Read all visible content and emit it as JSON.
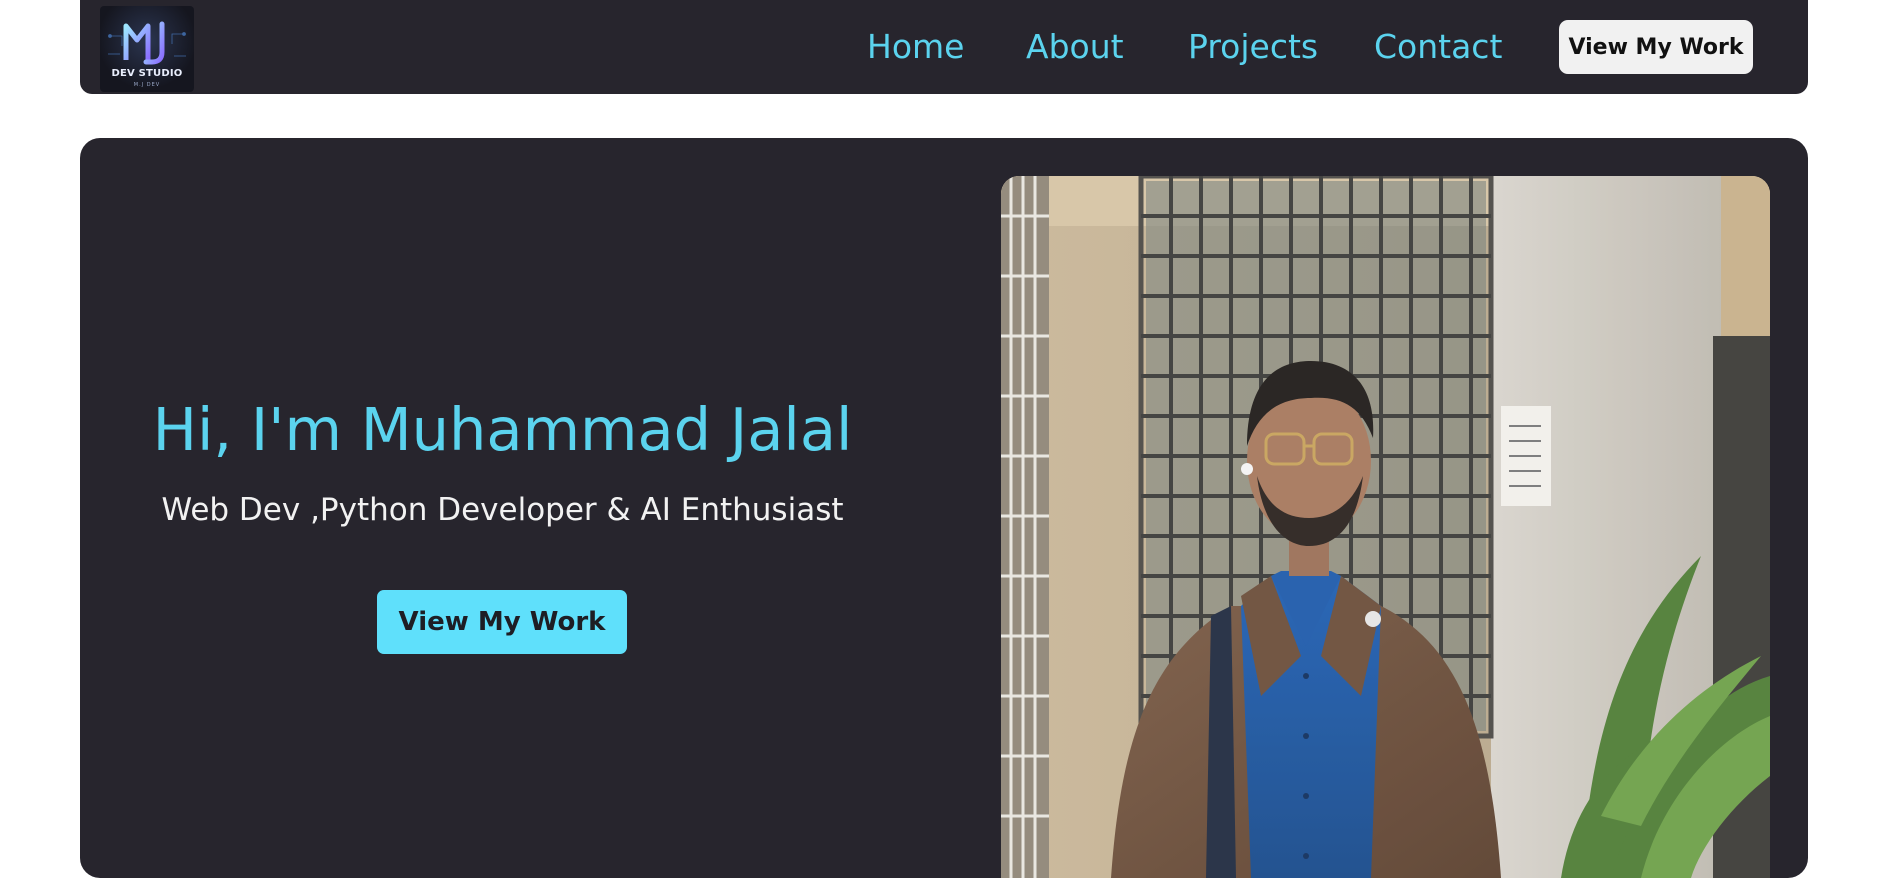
{
  "nav": {
    "logo": {
      "monogram": "MJ",
      "text": "DEV STUDIO",
      "subtext": "M.J DEV"
    },
    "links": [
      "Home",
      "About",
      "Projects",
      "Contact"
    ],
    "button_label": "View My Work"
  },
  "hero": {
    "title": "Hi, I'm Muhammad Jalal",
    "subtitle": "Web Dev ,Python Developer & AI Enthusiast",
    "button_label": "View My Work",
    "photo_alt": "Portrait photo"
  },
  "colors": {
    "background": "#ffffff",
    "panel": "#27252d",
    "accent": "#5bd3ee",
    "accent_button": "#5fe0fb",
    "nav_button": "#f1f1f1"
  }
}
